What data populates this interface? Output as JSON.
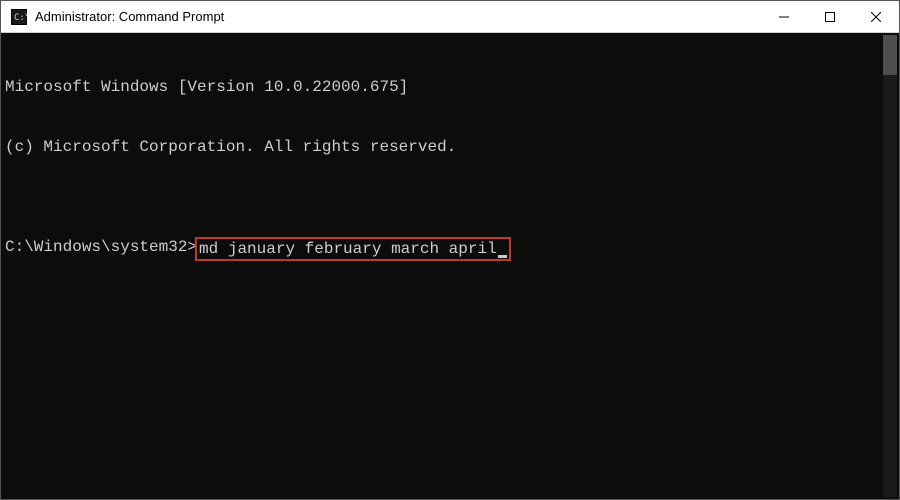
{
  "window": {
    "title": "Administrator: Command Prompt",
    "icon_name": "cmd-icon"
  },
  "terminal": {
    "lines": [
      "Microsoft Windows [Version 10.0.22000.675]",
      "(c) Microsoft Corporation. All rights reserved.",
      ""
    ],
    "prompt": "C:\\Windows\\system32>",
    "command": "md january february march april",
    "highlight_color": "#c0392b"
  },
  "controls": {
    "minimize": "Minimize",
    "maximize": "Maximize",
    "close": "Close"
  }
}
